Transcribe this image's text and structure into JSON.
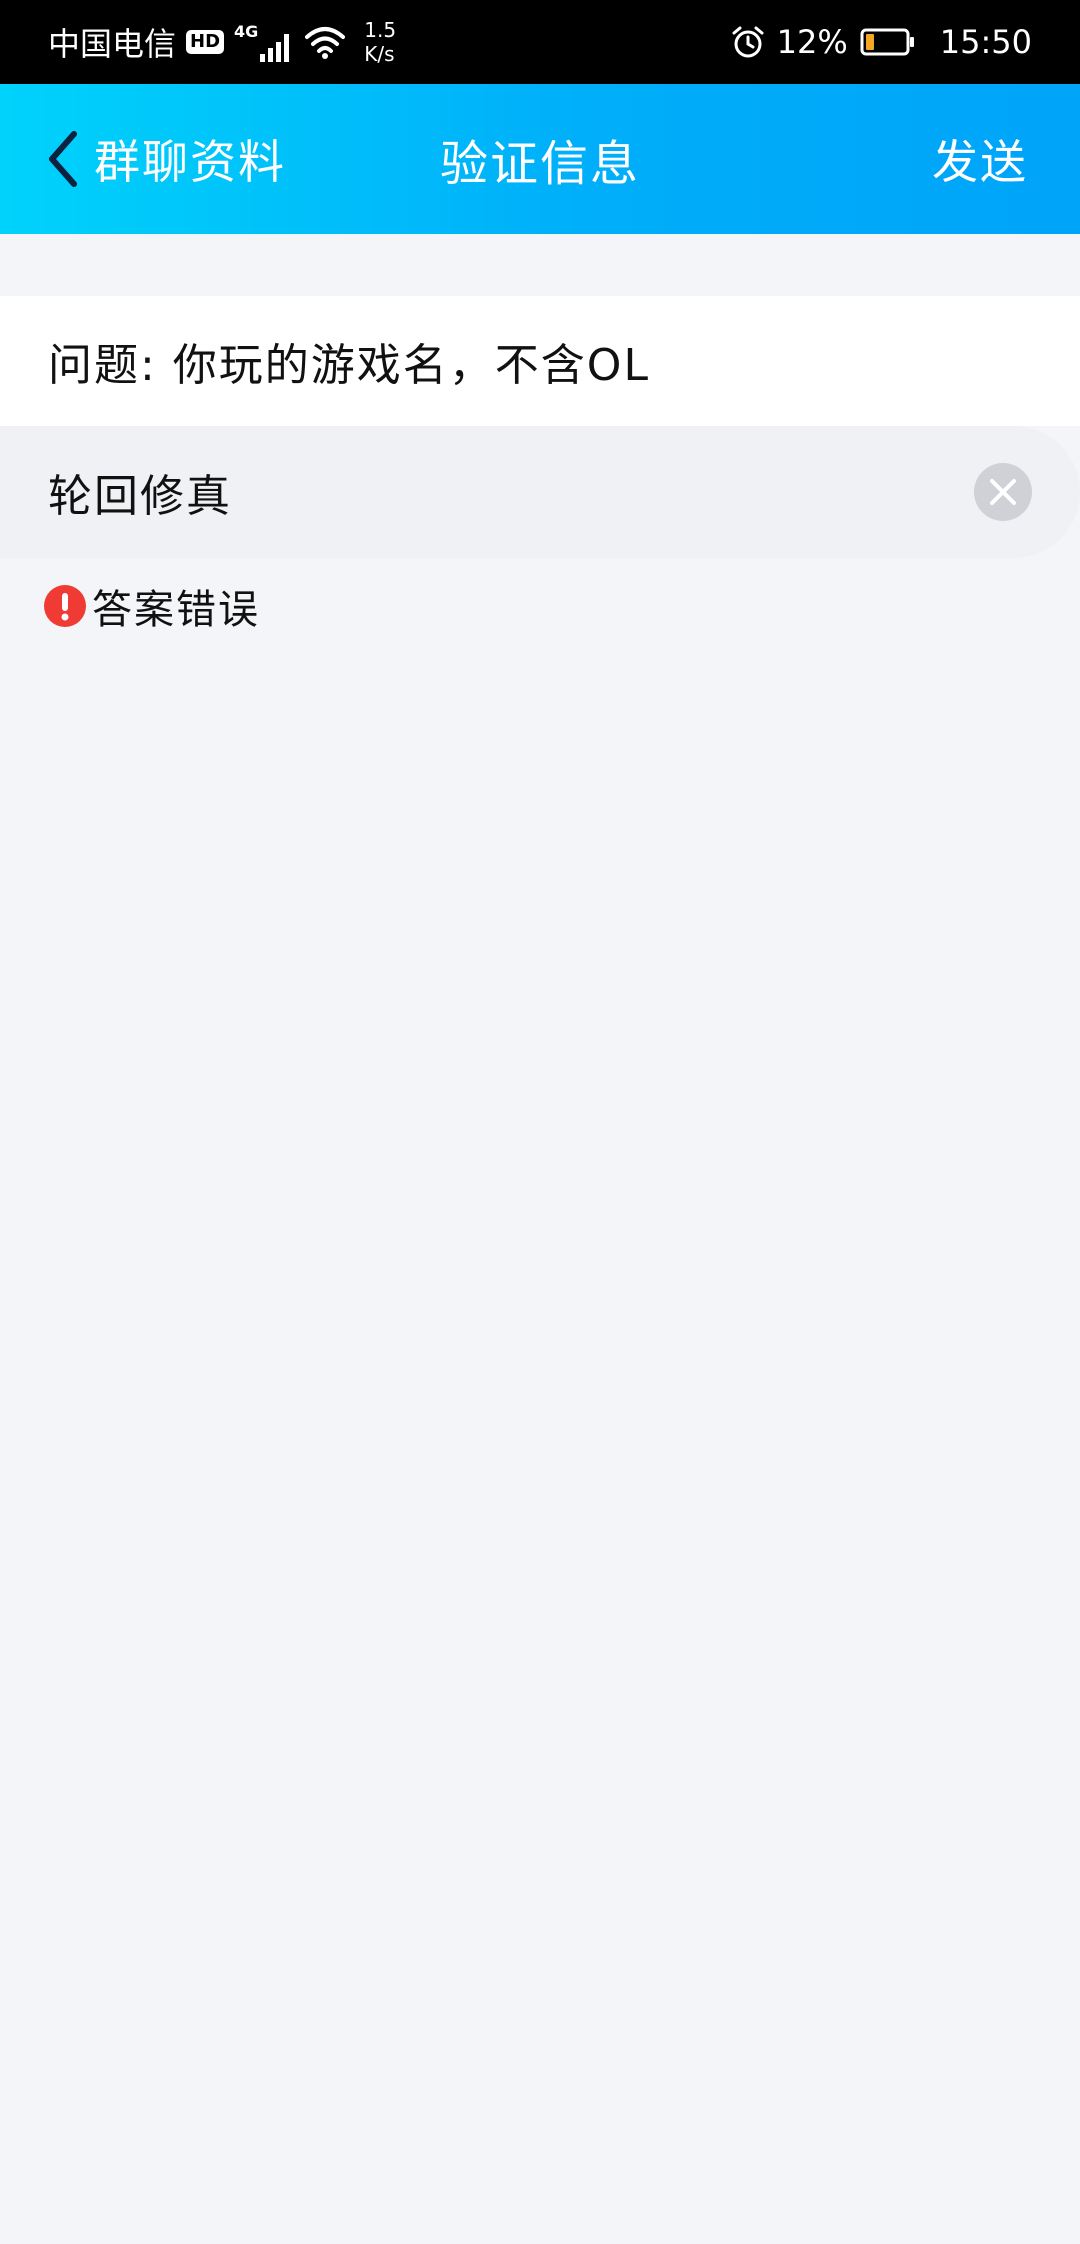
{
  "status_bar": {
    "carrier": "中国电信",
    "hd_badge": "HD",
    "network": "4G",
    "speed_value": "1.5",
    "speed_unit": "K/s",
    "battery_percent": "12%",
    "time": "15:50",
    "icons": [
      "signal-icon",
      "wifi-icon",
      "alarm-icon",
      "battery-icon"
    ]
  },
  "nav": {
    "back_label": "群聊资料",
    "title": "验证信息",
    "send_label": "发送"
  },
  "form": {
    "question": "问题: 你玩的游戏名，不含OL",
    "answer_value": "轮回修真",
    "answer_placeholder": "",
    "error_message": "答案错误"
  },
  "colors": {
    "nav_gradient_start": "#00d2fb",
    "nav_gradient_end": "#00a4f9",
    "error_red": "#ef3b34",
    "page_background": "#f3f5f9"
  }
}
